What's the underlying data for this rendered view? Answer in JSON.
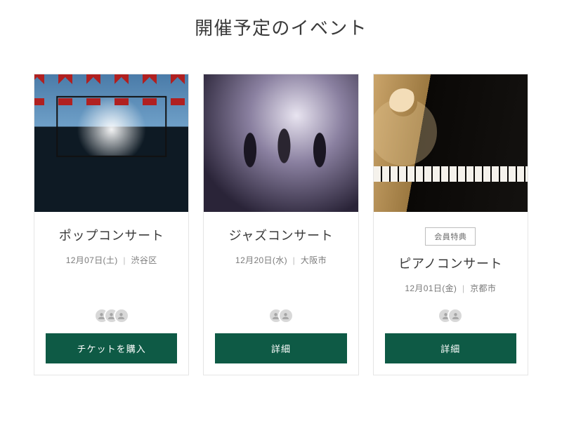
{
  "page_title": "開催予定のイベント",
  "meta_separator": "|",
  "events": [
    {
      "image_alt": "pop-concert-stage",
      "badge": null,
      "title": "ポップコンサート",
      "date": "12月07日(土)",
      "location": "渋谷区",
      "attendee_avatars": 3,
      "cta_label": "チケットを購入"
    },
    {
      "image_alt": "jazz-band",
      "badge": null,
      "title": "ジャズコンサート",
      "date": "12月20日(水)",
      "location": "大阪市",
      "attendee_avatars": 2,
      "cta_label": "詳細"
    },
    {
      "image_alt": "pianist",
      "badge": "会員特典",
      "title": "ピアノコンサート",
      "date": "12月01日(金)",
      "location": "京都市",
      "attendee_avatars": 2,
      "cta_label": "詳細"
    }
  ],
  "colors": {
    "cta_bg": "#0e5a45",
    "cta_text": "#ffffff"
  }
}
